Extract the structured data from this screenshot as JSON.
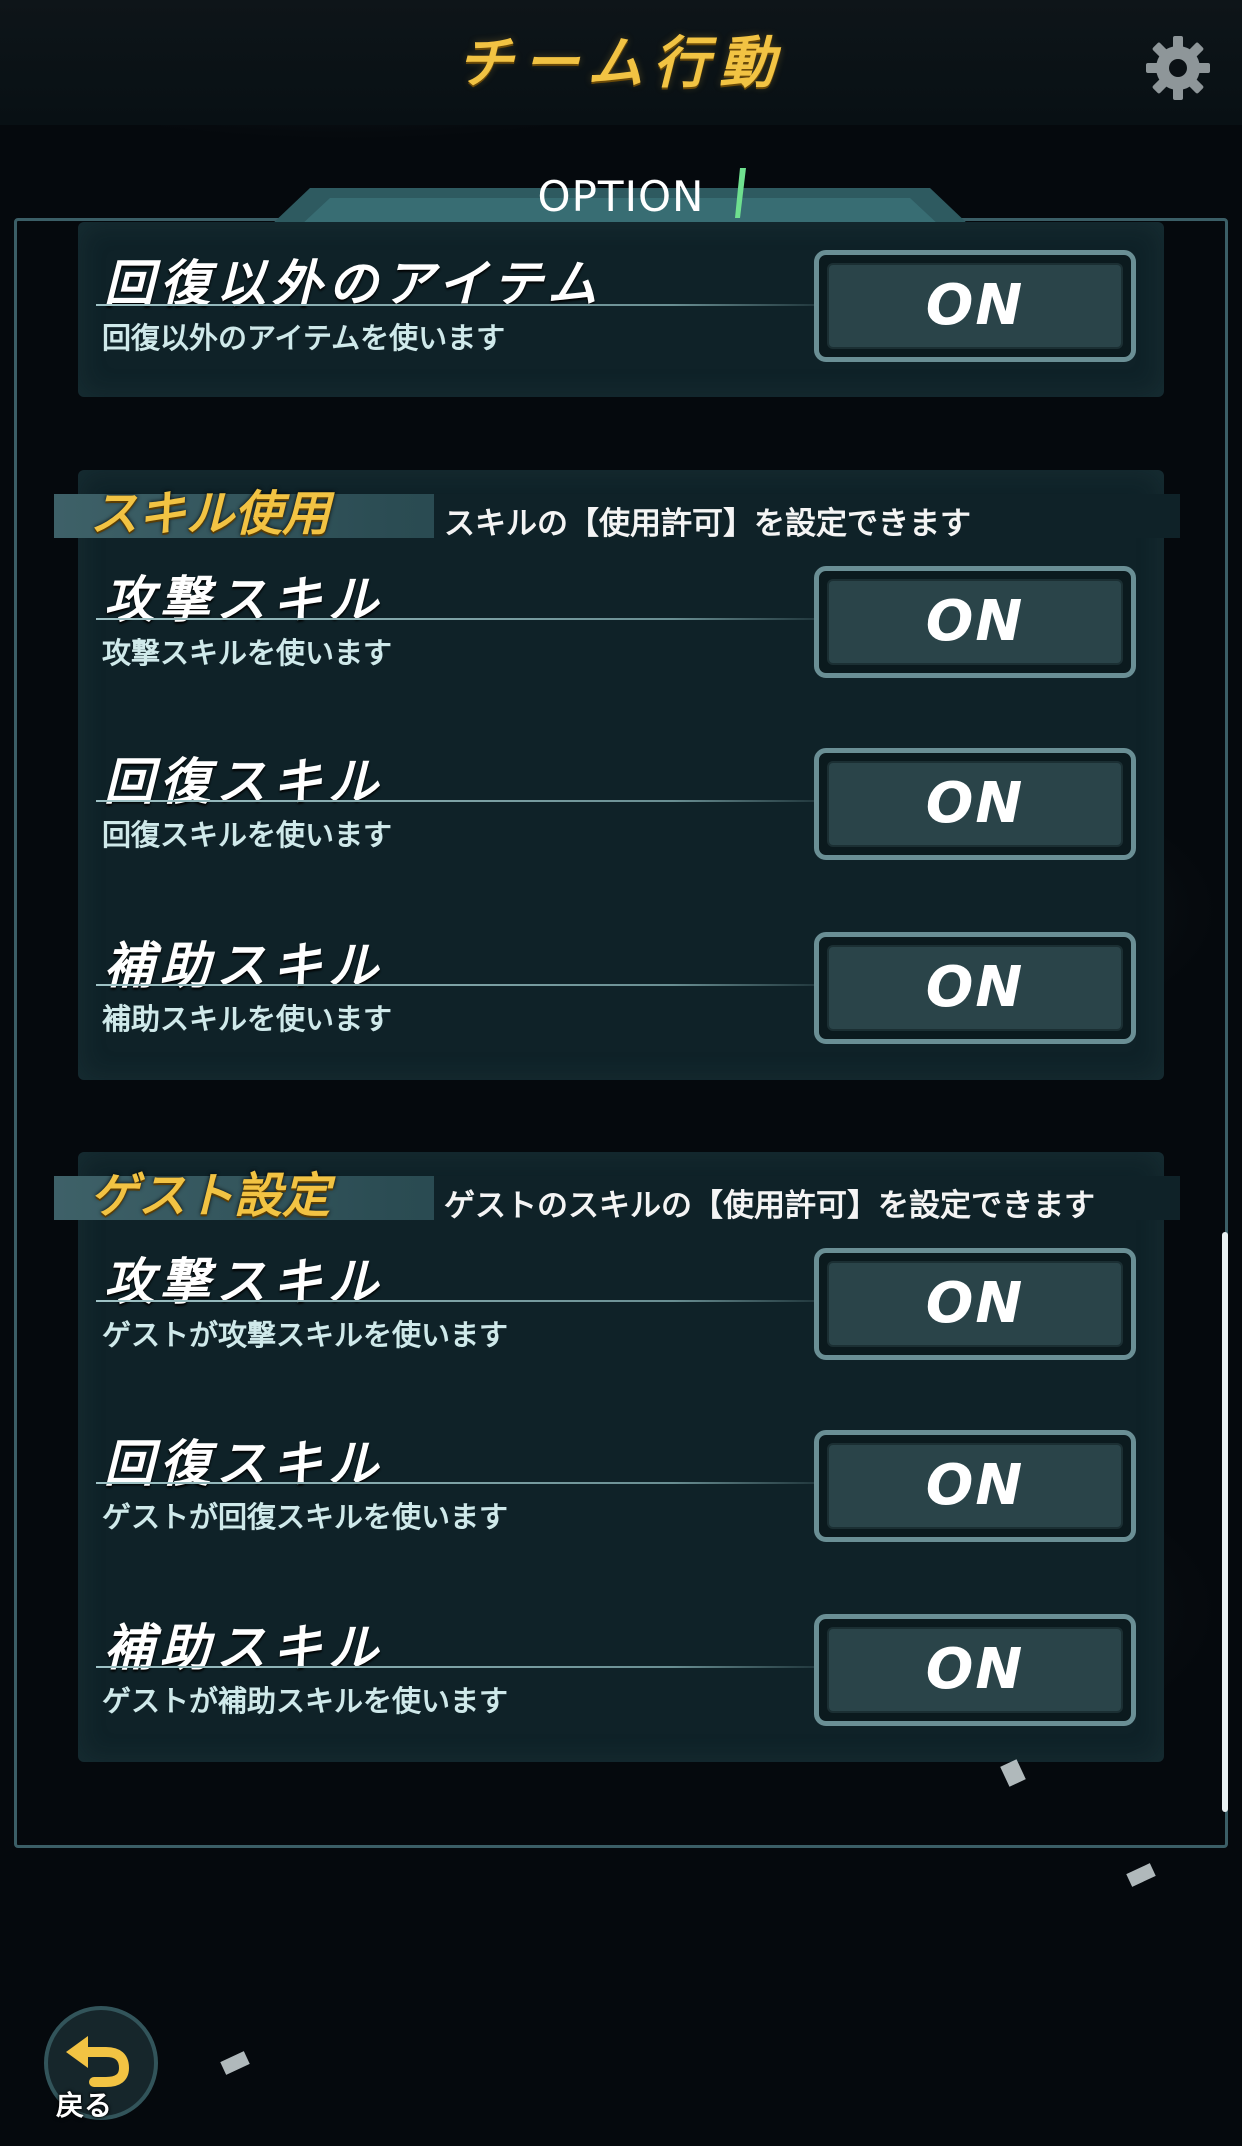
{
  "header": {
    "title": "チーム行動",
    "settings_icon": "gear-icon"
  },
  "panel": {
    "tab_label": "OPTION"
  },
  "items_section": {
    "rows": [
      {
        "title": "回復以外のアイテム",
        "desc": "回復以外のアイテムを使います",
        "toggle": "ON"
      }
    ]
  },
  "skill_section": {
    "title": "スキル使用",
    "desc": "スキルの【使用許可】を設定できます",
    "rows": [
      {
        "title": "攻撃スキル",
        "desc": "攻撃スキルを使います",
        "toggle": "ON"
      },
      {
        "title": "回復スキル",
        "desc": "回復スキルを使います",
        "toggle": "ON"
      },
      {
        "title": "補助スキル",
        "desc": "補助スキルを使います",
        "toggle": "ON"
      }
    ]
  },
  "guest_section": {
    "title": "ゲスト設定",
    "desc": "ゲストのスキルの【使用許可】を設定できます",
    "rows": [
      {
        "title": "攻撃スキル",
        "desc": "ゲストが攻撃スキルを使います",
        "toggle": "ON"
      },
      {
        "title": "回復スキル",
        "desc": "ゲストが回復スキルを使います",
        "toggle": "ON"
      },
      {
        "title": "補助スキル",
        "desc": "ゲストが補助スキルを使います",
        "toggle": "ON"
      }
    ]
  },
  "footer": {
    "back_label": "戻る",
    "back_icon": "undo-arrow-icon"
  },
  "colors": {
    "accent_gold": "#f2c343",
    "panel_teal": "#0f2228",
    "frame": "#3b5e66"
  }
}
